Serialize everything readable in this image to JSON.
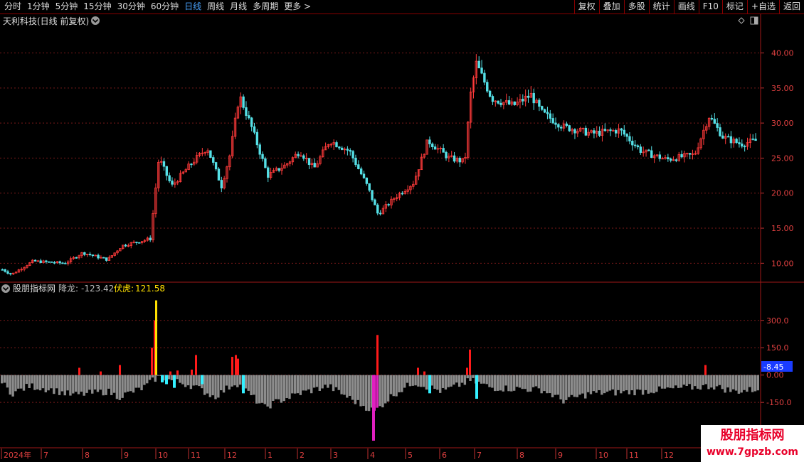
{
  "toolbar": {
    "left_tabs": [
      "分时",
      "1分钟",
      "5分钟",
      "15分钟",
      "30分钟",
      "60分钟",
      "日线",
      "周线",
      "月线",
      "多周期",
      "更多"
    ],
    "active_tab": "日线",
    "more_arrow": ">",
    "right_tabs": [
      "复权",
      "叠加",
      "多股",
      "统计",
      "画线",
      "F10",
      "标记",
      "+自选",
      "返回"
    ]
  },
  "main_panel": {
    "title": "天利科技(日线 前复权)",
    "price_axis": [
      "40.00",
      "35.00",
      "30.00",
      "25.00",
      "20.00",
      "15.00",
      "10.00"
    ],
    "price_range": [
      7.5,
      43.5
    ]
  },
  "indicator_panel": {
    "name": "股朋指标网",
    "series1_label": "降龙: ",
    "series1_value": "-123.42",
    "series2_label": "伏虎: ",
    "series2_value": "121.58",
    "axis": [
      "300.0",
      "150.0",
      "0.00",
      "-150.0"
    ],
    "current_value_badge": "-8.45",
    "range": [
      -360,
      420
    ]
  },
  "time_axis": [
    "2024年",
    "7",
    "8",
    "9",
    "10",
    "11",
    "12",
    "1",
    "2",
    "3",
    "4",
    "5",
    "6",
    "7",
    "8",
    "9",
    "10",
    "11",
    "12"
  ],
  "colors": {
    "up": "#ff3a3a",
    "down": "#55e0e6",
    "gray_bar": "#8c8c8c",
    "magenta_bar": "#e020c0",
    "yellow_bar": "#ffe000",
    "cyan_bar": "#33f0ff",
    "red_bar": "#ff1a1a",
    "grid": "#7a1a1a",
    "axis_text": "#e04040"
  },
  "watermark": {
    "line1": "股朋指标网",
    "line2": "www.7gpzb.com"
  }
}
